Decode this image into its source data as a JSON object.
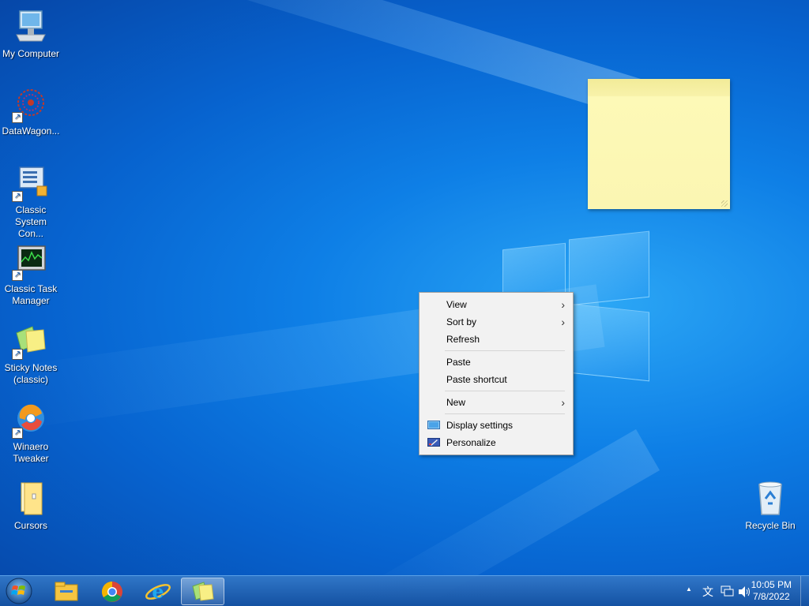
{
  "desktop_icons": [
    {
      "label": "My Computer",
      "icon": "computer-icon",
      "shortcut": false
    },
    {
      "label": "DataWagon...",
      "icon": "datawagon-icon",
      "shortcut": true
    },
    {
      "label": "Classic System Con...",
      "icon": "control-panel-icon",
      "shortcut": true
    },
    {
      "label": "Classic Task Manager",
      "icon": "task-manager-icon",
      "shortcut": true
    },
    {
      "label": "Sticky Notes (classic)",
      "icon": "sticky-notes-icon",
      "shortcut": true
    },
    {
      "label": "Winaero Tweaker",
      "icon": "winaero-tweaker-icon",
      "shortcut": true
    },
    {
      "label": "Cursors",
      "icon": "folder-icon",
      "shortcut": false
    }
  ],
  "recycle_bin": {
    "label": "Recycle Bin"
  },
  "context_menu": {
    "view": "View",
    "sort_by": "Sort by",
    "refresh": "Refresh",
    "paste": "Paste",
    "paste_shortcut": "Paste shortcut",
    "new": "New",
    "display_settings": "Display settings",
    "personalize": "Personalize"
  },
  "taskbar": {
    "clock_time": "10:05 PM",
    "clock_date": "7/8/2022",
    "tray_overflow": "▲",
    "colors": {
      "accent": "#0e7fe6"
    }
  }
}
